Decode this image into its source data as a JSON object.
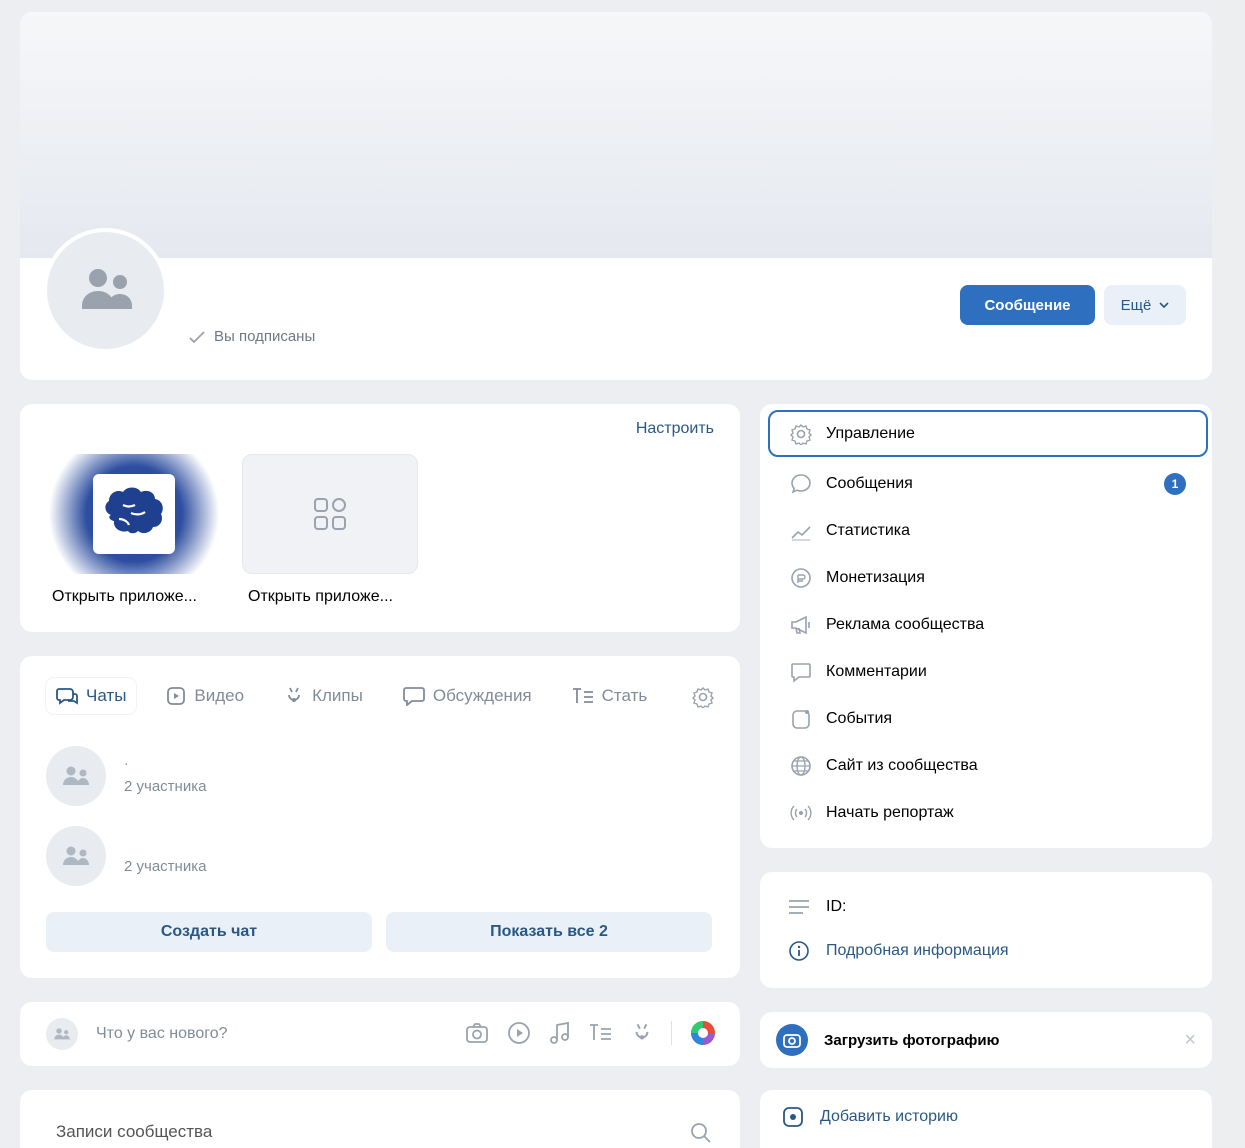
{
  "profile": {
    "subscribed_label": "Вы подписаны",
    "message_button": "Сообщение",
    "more_button": "Ещё"
  },
  "apps": {
    "configure_label": "Настроить",
    "items": [
      {
        "label": "Открыть приложе...",
        "icon": "brain-icon"
      },
      {
        "label": "Открыть приложе...",
        "icon": "apps-grid-icon"
      }
    ]
  },
  "chats": {
    "tabs": [
      {
        "label": "Чаты",
        "icon": "chat-icon",
        "active": true
      },
      {
        "label": "Видео",
        "icon": "video-icon",
        "active": false
      },
      {
        "label": "Клипы",
        "icon": "clips-icon",
        "active": false
      },
      {
        "label": "Обсуждения",
        "icon": "discussion-icon",
        "active": false
      },
      {
        "label": "Стать",
        "icon": "articles-icon",
        "active": false
      }
    ],
    "rows": [
      {
        "title": "·",
        "subtitle": "2 участника"
      },
      {
        "title": "",
        "subtitle": "2 участника"
      }
    ],
    "create_button": "Создать чат",
    "show_all_button": "Показать все 2"
  },
  "composer": {
    "placeholder": "Что у вас нового?"
  },
  "posts": {
    "title": "Записи сообщества"
  },
  "menu": {
    "items": [
      {
        "label": "Управление",
        "icon": "gear-icon"
      },
      {
        "label": "Сообщения",
        "icon": "message-icon",
        "badge": "1"
      },
      {
        "label": "Статистика",
        "icon": "stats-icon"
      },
      {
        "label": "Монетизация",
        "icon": "coin-icon"
      },
      {
        "label": "Реклама сообщества",
        "icon": "megaphone-icon"
      },
      {
        "label": "Комментарии",
        "icon": "comment-icon"
      },
      {
        "label": "События",
        "icon": "event-icon"
      },
      {
        "label": "Сайт из сообщества",
        "icon": "globe-icon"
      },
      {
        "label": "Начать репортаж",
        "icon": "broadcast-icon"
      }
    ]
  },
  "info": {
    "id_label": "ID:",
    "details_link": "Подробная информация"
  },
  "upload": {
    "label": "Загрузить фотографию",
    "close": "×"
  },
  "story": {
    "label": "Добавить историю"
  },
  "colors": {
    "accent": "#2e6fbf",
    "link": "#2a5885",
    "muted": "#818c99",
    "background": "#edeef0"
  }
}
